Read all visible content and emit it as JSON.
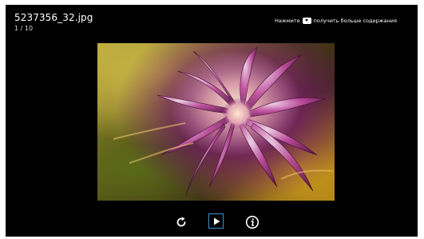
{
  "viewer": {
    "filename": "5237356_32.jpg",
    "counter": "1 / 10",
    "hint_before": "Нажмите",
    "hint_after": "получить больше содержания",
    "hint_key_icon": "down-arrow-key-icon"
  },
  "controls": {
    "items": [
      {
        "icon": "rotate-icon",
        "selected": false
      },
      {
        "icon": "slideshow-play-icon",
        "selected": true
      },
      {
        "icon": "info-icon",
        "selected": false
      }
    ],
    "focus_color": "#3f8fd0",
    "icon_color": "#ffffff"
  },
  "photo": {
    "subject": "macro-flower-photo",
    "colors": [
      "#8e2b7c",
      "#d4c24a",
      "#d3a21d",
      "#f2dcc6"
    ]
  }
}
